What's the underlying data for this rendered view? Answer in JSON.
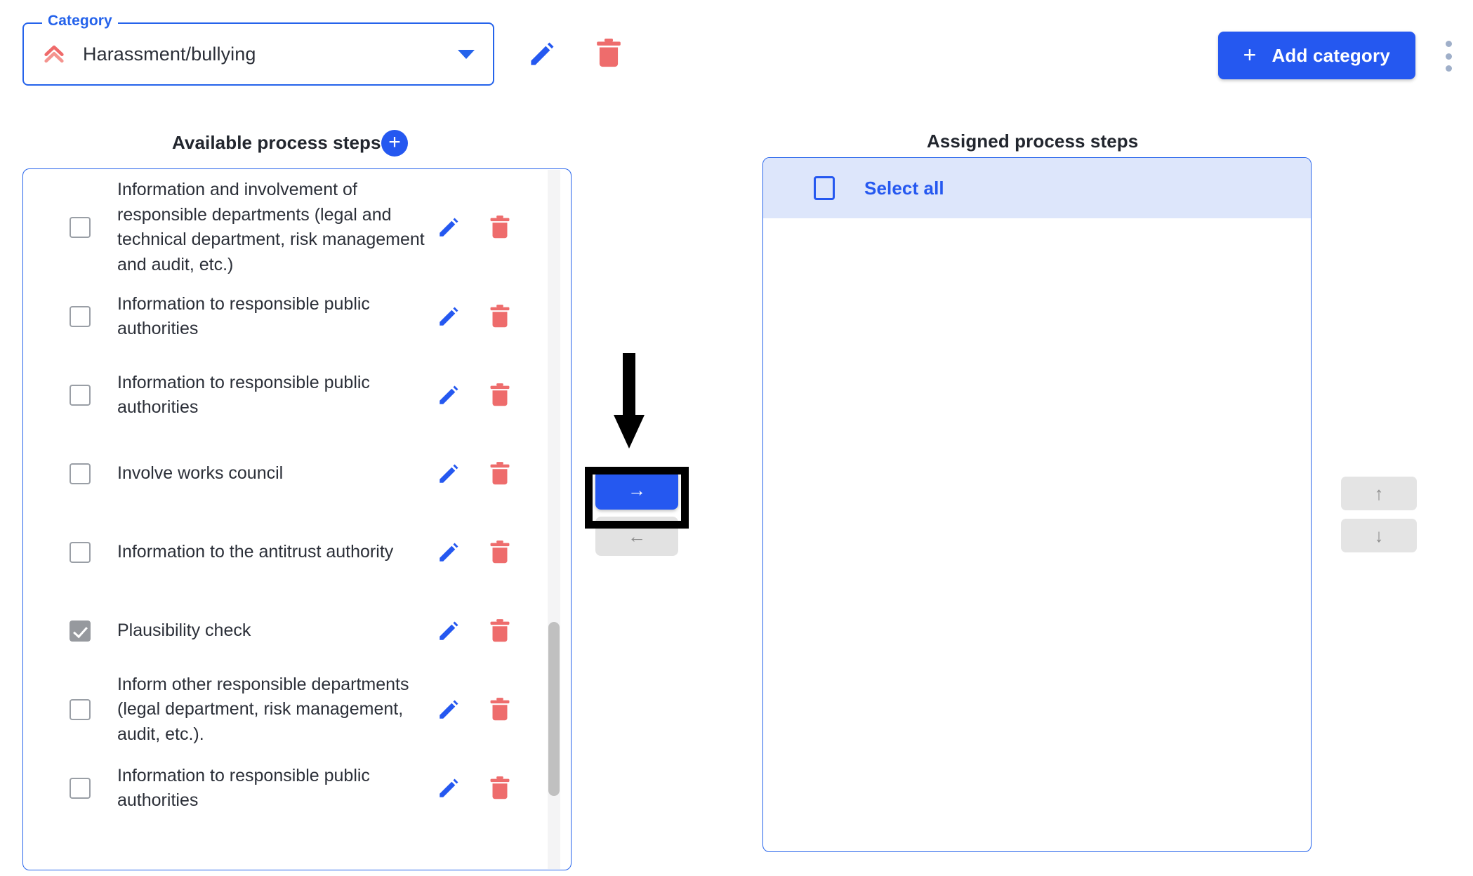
{
  "category": {
    "legend": "Category",
    "value": "Harassment/bullying",
    "priority_icon": "double-chevron-up-icon",
    "caret_icon": "chevron-down-icon",
    "edit_icon": "pencil-icon",
    "delete_icon": "trash-icon",
    "accent_color": "#2563EB",
    "priority_color": "#EF6A6A"
  },
  "toolbar": {
    "add_category_label": "Add category",
    "add_category_plus": "+",
    "add_category_color": "#2558F0",
    "overflow_icon": "kebab-menu-icon"
  },
  "available": {
    "heading": "Available process steps",
    "add_step_label": "+",
    "steps": [
      {
        "label": "Information and involvement of responsible departments (legal and technical department, risk management and audit, etc.)",
        "checked": false
      },
      {
        "label": "Information to responsible public authorities",
        "checked": false
      },
      {
        "label": "Information to responsible public authorities",
        "checked": false
      },
      {
        "label": "Involve works council",
        "checked": false
      },
      {
        "label": "Information to the antitrust authority",
        "checked": false
      },
      {
        "label": "Plausibility check",
        "checked": true
      },
      {
        "label": "Inform other responsible departments (legal department, risk management, audit, etc.).",
        "checked": false
      },
      {
        "label": "Information to responsible public authorities",
        "checked": false
      }
    ]
  },
  "transfer": {
    "to_assigned_label": "→",
    "to_available_label": "←",
    "to_assigned_enabled": true,
    "to_available_enabled": false,
    "annotation": "black-arrow-highlight-on-move-right-button"
  },
  "assigned": {
    "heading": "Assigned process steps",
    "select_all_label": "Select all",
    "select_all_checked": false,
    "items": []
  },
  "reorder": {
    "move_up_label": "↑",
    "move_down_label": "↓",
    "enabled": false
  }
}
